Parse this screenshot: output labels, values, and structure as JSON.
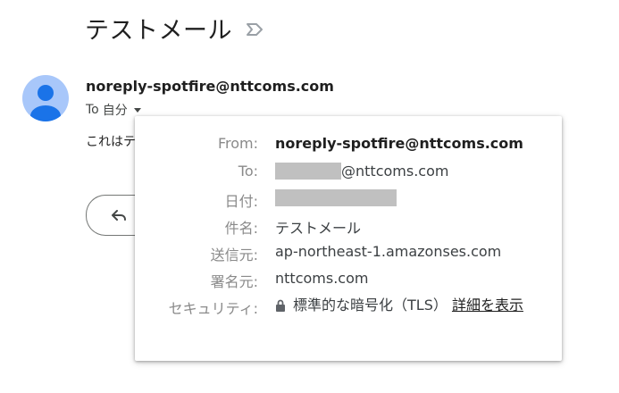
{
  "email": {
    "subject": "テストメール",
    "sender": "noreply-spotfire@nttcoms.com",
    "to_prefix": "To",
    "to_value": "自分",
    "snippet": "これはテ"
  },
  "details": {
    "from_label": "From:",
    "from_value": "noreply-spotfire@nttcoms.com",
    "to_label": "To:",
    "to_value_suffix": "@nttcoms.com",
    "date_label": "日付:",
    "subject_label": "件名:",
    "subject_value": "テストメール",
    "mailed_by_label": "送信元:",
    "mailed_by_value": "ap-northeast-1.amazonses.com",
    "signed_by_label": "署名元:",
    "signed_by_value": "nttcoms.com",
    "security_label": "セキュリティ:",
    "security_value": "標準的な暗号化（TLS）",
    "security_link": "詳細を表示"
  },
  "colors": {
    "avatar_bg": "#a8c7fa",
    "avatar_fg": "#1a73e8",
    "label_gray": "#8a8a8a",
    "redaction": "#c0c0c0"
  },
  "icons": {
    "label": "label-outline-icon",
    "avatar": "person-icon",
    "dropdown": "caret-down-icon",
    "reply": "reply-icon",
    "lock": "lock-icon"
  }
}
